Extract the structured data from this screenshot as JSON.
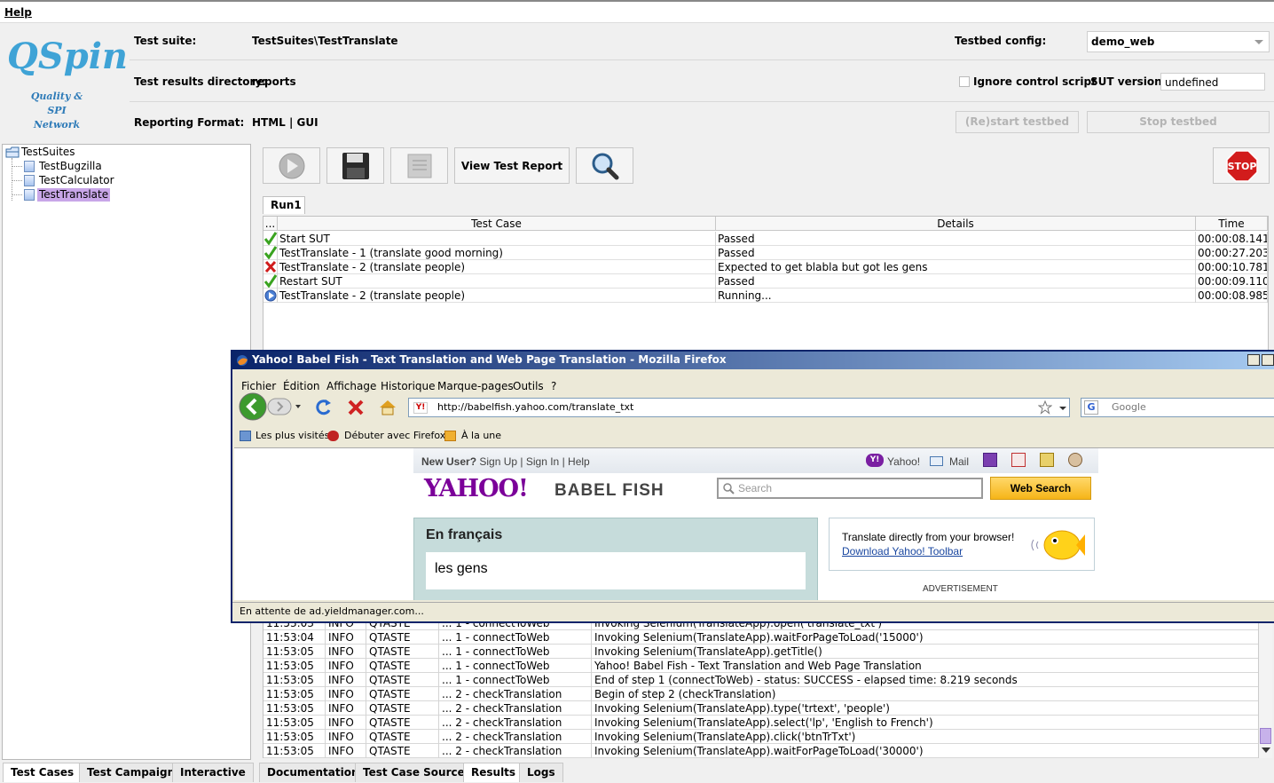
{
  "menubar": {
    "help": "Help"
  },
  "logo": {
    "title": "QSpin",
    "line1": "Quality & SPI",
    "line2": "Network"
  },
  "header": {
    "suite_label": "Test suite:",
    "suite_value": "TestSuites\\TestTranslate",
    "results_label": "Test results directory:",
    "results_value": "reports",
    "format_label": "Reporting Format:",
    "format_value": "HTML | GUI",
    "testbed_label": "Testbed config:",
    "testbed_value": "demo_web",
    "ignore_label": "Ignore control script",
    "sut_label": "SUT version:",
    "sut_value": "undefined",
    "restart_label": "(Re)start testbed",
    "stop_label": "Stop testbed"
  },
  "tree": {
    "root": "TestSuites",
    "items": [
      "TestBugzilla",
      "TestCalculator",
      "TestTranslate"
    ]
  },
  "left_tabs": [
    "Test Cases",
    "Test Campaign",
    "Interactive"
  ],
  "toolbar": {
    "view_report": "View Test Report",
    "stop_label": "STOP"
  },
  "run_tab": "Run1",
  "results_table": {
    "headers": [
      "...",
      "Test Case",
      "Details",
      "Time"
    ],
    "rows": [
      {
        "status": "pass",
        "case": "Start SUT",
        "details": "Passed",
        "time": "00:00:08.141"
      },
      {
        "status": "pass",
        "case": "TestTranslate - 1 (translate good morning)",
        "details": "Passed",
        "time": "00:00:27.203"
      },
      {
        "status": "fail",
        "case": "TestTranslate - 2 (translate people)",
        "details": "Expected to get blabla but got les gens",
        "time": "00:00:10.781"
      },
      {
        "status": "pass",
        "case": "Restart SUT",
        "details": "Passed",
        "time": "00:00:09.110"
      },
      {
        "status": "running",
        "case": "TestTranslate - 2 (translate people)",
        "details": "Running...",
        "time": "00:00:08.985"
      }
    ]
  },
  "firefox": {
    "title": "Yahoo! Babel Fish - Text Translation and Web Page Translation - Mozilla Firefox",
    "menus": [
      "Fichier",
      "Édition",
      "Affichage",
      "Historique",
      "Marque-pages",
      "Outils",
      "?"
    ],
    "url": "http://babelfish.yahoo.com/translate_txt",
    "search_placeholder": "Google",
    "bookmarks": [
      "Les plus visités",
      "Débuter avec Firefox",
      "À la une"
    ],
    "status": "En attente de ad.yieldmanager.com...",
    "page": {
      "new_user": "New User?",
      "sign_up": "Sign Up",
      "sign_in": "Sign In",
      "help": "Help",
      "yahoo": "Yahoo!",
      "mail": "Mail",
      "brand": "YAHOO!",
      "babel": "BABEL FISH",
      "search_placeholder": "Search",
      "web_search": "Web Search",
      "box_title": "En français",
      "translated": "les gens",
      "promo_text": "Translate directly from your browser!",
      "promo_link": "Download Yahoo! Toolbar",
      "advertisement": "ADVERTISEMENT"
    }
  },
  "logs": {
    "rows": [
      [
        "11:53:03",
        "INFO",
        "QTASTE",
        "... 1 - connectToWeb",
        "Invoking Selenium(TranslateApp).open('translate_txt')"
      ],
      [
        "11:53:04",
        "INFO",
        "QTASTE",
        "... 1 - connectToWeb",
        "Invoking Selenium(TranslateApp).waitForPageToLoad('15000')"
      ],
      [
        "11:53:05",
        "INFO",
        "QTASTE",
        "... 1 - connectToWeb",
        "Invoking Selenium(TranslateApp).getTitle()"
      ],
      [
        "11:53:05",
        "INFO",
        "QTASTE",
        "... 1 - connectToWeb",
        "Yahoo! Babel Fish - Text Translation and Web Page Translation"
      ],
      [
        "11:53:05",
        "INFO",
        "QTASTE",
        "... 1 - connectToWeb",
        "End of step 1 (connectToWeb) - status: SUCCESS - elapsed time: 8.219 seconds"
      ],
      [
        "11:53:05",
        "INFO",
        "QTASTE",
        "... 2 - checkTranslation",
        "Begin of step 2 (checkTranslation)"
      ],
      [
        "11:53:05",
        "INFO",
        "QTASTE",
        "... 2 - checkTranslation",
        "Invoking Selenium(TranslateApp).type('trtext', 'people')"
      ],
      [
        "11:53:05",
        "INFO",
        "QTASTE",
        "... 2 - checkTranslation",
        "Invoking Selenium(TranslateApp).select('lp', 'English to French')"
      ],
      [
        "11:53:05",
        "INFO",
        "QTASTE",
        "... 2 - checkTranslation",
        "Invoking Selenium(TranslateApp).click('btnTrTxt')"
      ],
      [
        "11:53:05",
        "INFO",
        "QTASTE",
        "... 2 - checkTranslation",
        "Invoking Selenium(TranslateApp).waitForPageToLoad('30000')"
      ]
    ]
  },
  "right_tabs": [
    "Documentation",
    "Test Case Source",
    "Results",
    "Logs"
  ]
}
